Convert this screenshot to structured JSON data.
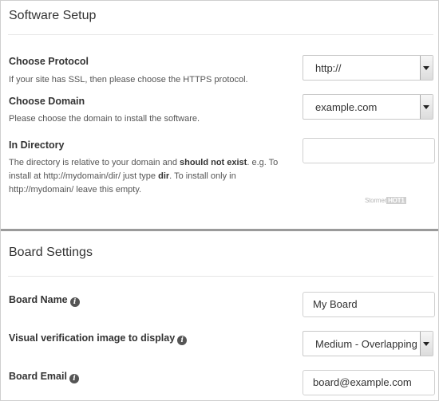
{
  "software_setup": {
    "title": "Software Setup",
    "protocol": {
      "label": "Choose Protocol",
      "help": "If your site has SSL, then please choose the HTTPS protocol.",
      "value": "http://"
    },
    "domain": {
      "label": "Choose Domain",
      "help": "Please choose the domain to install the software.",
      "value": "example.com"
    },
    "directory": {
      "label": "In Directory",
      "help_1": "The directory is relative to your domain and ",
      "help_bold_1": "should not exist",
      "help_2": ". e.g. To install at http://mydomain/dir/ just type ",
      "help_bold_2": "dir",
      "help_3": ". To install only in http://mydomain/ leave this empty.",
      "value": ""
    },
    "watermark": {
      "text": "Stormer",
      "badge": "HOT1"
    }
  },
  "board_settings": {
    "title": "Board Settings",
    "board_name": {
      "label": "Board Name",
      "value": "My Board"
    },
    "verification": {
      "label": "Visual verification image to display",
      "value": "Medium - Overlapping"
    },
    "board_email": {
      "label": "Board Email",
      "value": "board@example.com"
    }
  },
  "icons": {
    "info": "info-circle-icon",
    "dropdown": "chevron-down-icon"
  }
}
